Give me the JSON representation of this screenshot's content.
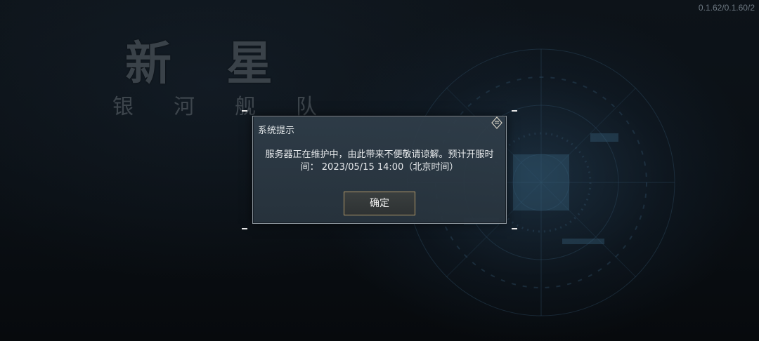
{
  "version": "0.1.62/0.1.60/2",
  "logo": {
    "title": "新星",
    "subtitle": "银河舰队"
  },
  "dialog": {
    "title": "系统提示",
    "message_line1": "服务器正在维护中，由此带来不便敬请谅解。预计开服时",
    "message_line2": "间： 2023/05/15 14:00（北京时间）",
    "confirm_label": "确定"
  },
  "icons": {
    "close": "diamond-close-icon"
  },
  "colors": {
    "background": "#0a0e13",
    "dialog_bg": "#33414d",
    "dialog_border": "#8c959c",
    "button_border": "#b39a6a"
  }
}
